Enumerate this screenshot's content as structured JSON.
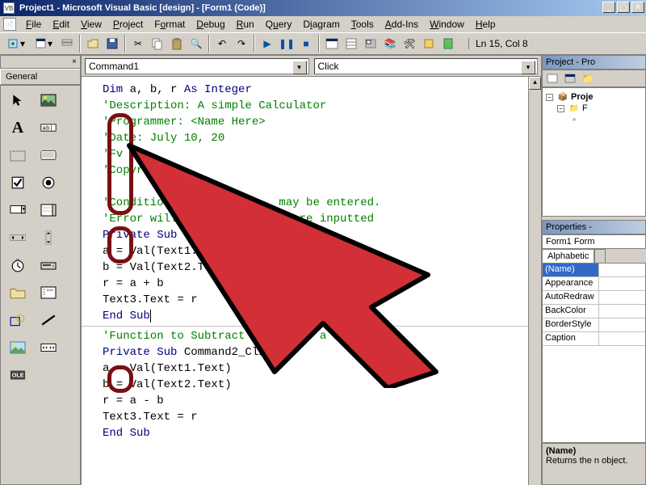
{
  "titlebar": {
    "app_title": "Project1 - Microsoft Visual Basic [design] - [Form1 (Code)]"
  },
  "menubar": {
    "items": [
      "File",
      "Edit",
      "View",
      "Project",
      "Format",
      "Debug",
      "Run",
      "Query",
      "Diagram",
      "Tools",
      "Add-Ins",
      "Window",
      "Help"
    ]
  },
  "status": {
    "cursor_pos": "Ln 15, Col 8"
  },
  "left_panel": {
    "close_label": "×",
    "tab_label": "General"
  },
  "combo": {
    "object": "Command1",
    "event": "Click"
  },
  "code": {
    "lines": [
      {
        "t": "Dim a, b, r As Integer",
        "cls": "kw-dim"
      },
      {
        "t": "'Description: A simple Calculator",
        "cls": "cm"
      },
      {
        "t": "'Programmer: <Name Here>",
        "cls": "cm"
      },
      {
        "t": "'Date: July 10, 20",
        "cls": "cm"
      },
      {
        "t": "'Fv",
        "cls": "cm"
      },
      {
        "t": "'Copyr",
        "cls": "cm"
      },
      {
        "t": "",
        "cls": ""
      },
      {
        "t": "'Conditions               may be entered.",
        "cls": "cm"
      },
      {
        "t": "'Error will               s are inputted",
        "cls": "cm"
      },
      {
        "t": "Private Sub Com",
        "cls": "kw"
      },
      {
        "t": "a = Val(Text1.Te",
        "cls": ""
      },
      {
        "t": "b = Val(Text2.Text      riable",
        "cls": ""
      },
      {
        "t": "r = a + b               ult",
        "cls": ""
      },
      {
        "t": "Text3.Text = r          ult textfield",
        "cls": ""
      },
      {
        "t": "End Sub",
        "cls": "kw"
      },
      {
        "t": "",
        "cls": ""
      },
      {
        "t": "'Function to Subtract variables a & b",
        "cls": "cm"
      },
      {
        "t": "Private Sub Command2_Click()",
        "cls": "kw"
      },
      {
        "t": "a = Val(Text1.Text)",
        "cls": ""
      },
      {
        "t": "b = Val(Text2.Text)",
        "cls": ""
      },
      {
        "t": "r = a - b",
        "cls": ""
      },
      {
        "t": "Text3.Text = r",
        "cls": ""
      },
      {
        "t": "End Sub",
        "cls": "kw"
      }
    ]
  },
  "right_dock": {
    "project_title": "Project - Pro",
    "tree": {
      "root": "Proje",
      "folder": "F",
      "item": ""
    },
    "properties_title": "Properties - ",
    "prop_head": "Form1 Form",
    "tabs": {
      "alpha": "Alphabetic",
      "cat": ""
    },
    "rows": [
      {
        "n": "(Name)",
        "v": ""
      },
      {
        "n": "Appearance",
        "v": ""
      },
      {
        "n": "AutoRedraw",
        "v": ""
      },
      {
        "n": "BackColor",
        "v": ""
      },
      {
        "n": "BorderStyle",
        "v": ""
      },
      {
        "n": "Caption",
        "v": ""
      }
    ],
    "desc_title": "(Name)",
    "desc_body": "Returns the n\nobject."
  },
  "icons": {
    "toolbox": [
      "pointer-icon",
      "picturebox-icon",
      "label-icon",
      "textbox-icon",
      "frame-icon",
      "commandbutton-icon",
      "checkbox-icon",
      "optionbutton-icon",
      "combobox-icon",
      "listbox-icon",
      "hscroll-icon",
      "vscroll-icon",
      "timer-icon",
      "drivelist-icon",
      "dirlist-icon",
      "filelist-icon",
      "shape-icon",
      "line-icon",
      "image-icon",
      "data-icon",
      "ole-icon"
    ]
  }
}
